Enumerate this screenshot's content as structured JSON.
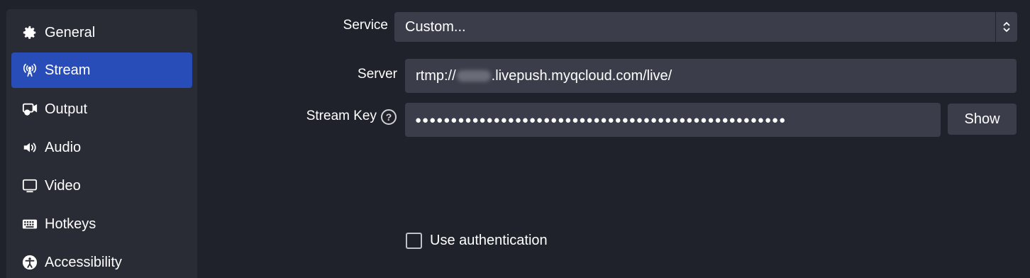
{
  "sidebar": {
    "items": [
      {
        "label": "General",
        "icon": "gear-icon"
      },
      {
        "label": "Stream",
        "icon": "antenna-icon",
        "active": true
      },
      {
        "label": "Output",
        "icon": "output-icon"
      },
      {
        "label": "Audio",
        "icon": "speaker-icon"
      },
      {
        "label": "Video",
        "icon": "monitor-icon"
      },
      {
        "label": "Hotkeys",
        "icon": "keyboard-icon"
      },
      {
        "label": "Accessibility",
        "icon": "accessibility-icon"
      }
    ]
  },
  "form": {
    "service_label": "Service",
    "service_value": "Custom...",
    "server_label": "Server",
    "server_prefix": "rtmp://",
    "server_suffix": ".livepush.myqcloud.com/live/",
    "stream_key_label": "Stream Key",
    "stream_key_value": "●●●●●●●●●●●●●●●●●●●●●●●●●●●●●●●●●●●●●●●●●●●●●●●●●●●●",
    "show_button": "Show",
    "use_auth_label": "Use authentication",
    "use_auth_checked": false
  },
  "colors": {
    "background": "#1f212b",
    "sidebar": "#292b35",
    "active": "#284cb8",
    "field": "#3b3e4a"
  }
}
